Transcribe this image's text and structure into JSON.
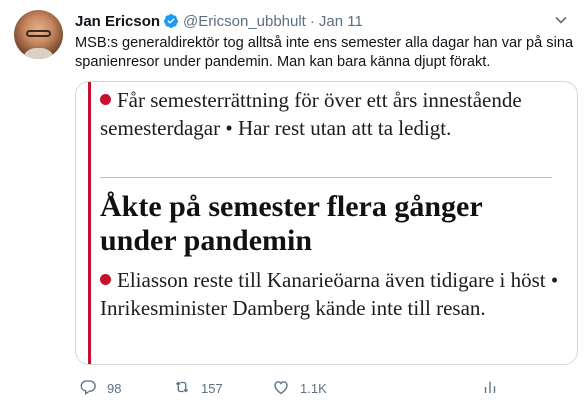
{
  "tweet": {
    "display_name": "Jan Ericson",
    "handle": "@Ericson_ubbhult",
    "separator": "·",
    "time": "Jan 11",
    "text": "MSB:s generaldirektör tog alltså inte ens semester alla dagar han var på sina spanienresor under pandemin. Man kan bara känna djupt förakt."
  },
  "media": {
    "paragraph1": "Får semesterrättning för över ett års innestående semesterdagar • Har rest utan att ta ledigt.",
    "headline": "Åkte på semester flera gånger under pandemin",
    "paragraph2": "Eliasson reste till Kanarieöarna även tidigare i höst • Inrikesminister Damberg kände inte till resan."
  },
  "actions": {
    "reply_count": "98",
    "retweet_count": "157",
    "like_count": "1.1K"
  },
  "icons": {
    "verified": "verified-badge-icon",
    "more": "chevron-down-icon",
    "reply": "reply-icon",
    "retweet": "retweet-icon",
    "like": "heart-icon",
    "share": "analytics-icon"
  },
  "colors": {
    "accent": "#1d9bf0",
    "muted": "#5b7083",
    "newspaper_red": "#c8102e"
  }
}
